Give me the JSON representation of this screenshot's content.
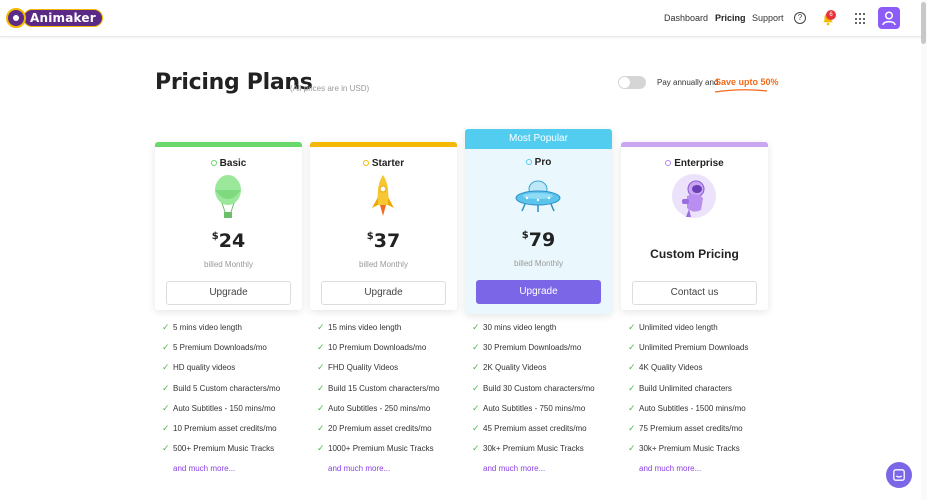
{
  "header": {
    "brand": "Animaker",
    "nav": {
      "dashboard": "Dashboard",
      "pricing": "Pricing",
      "support": "Support"
    },
    "help_glyph": "?",
    "notification_count": "6",
    "icons": [
      "help-icon",
      "bell-icon",
      "apps-grid-icon",
      "avatar-icon"
    ]
  },
  "page": {
    "title": "Pricing Plans",
    "subtitle": "(All prices are in USD)",
    "billing_toggle_label": "Pay annually and",
    "save_label": "Save upto 50%"
  },
  "plans": [
    {
      "name": "Basic",
      "accent": "#6bd86b",
      "currency": "$",
      "price": "24",
      "billed": "billed Monthly",
      "cta": "Upgrade",
      "features": [
        "5 mins video length",
        "5 Premium Downloads/mo",
        "HD quality videos",
        "Build 5 Custom characters/mo",
        "Auto Subtitles - 150 mins/mo",
        "10 Premium asset credits/mo",
        "500+ Premium Music Tracks"
      ],
      "more": "and much more..."
    },
    {
      "name": "Starter",
      "accent": "#f5b800",
      "currency": "$",
      "price": "37",
      "billed": "billed Monthly",
      "cta": "Upgrade",
      "features": [
        "15 mins video length",
        "10 Premium Downloads/mo",
        "FHD Quality Videos",
        "Build 15 Custom characters/mo",
        "Auto Subtitles - 250 mins/mo",
        "20 Premium asset credits/mo",
        "1000+ Premium Music Tracks"
      ],
      "more": "and much more..."
    },
    {
      "name": "Pro",
      "accent": "#52cdf0",
      "badge": "Most Popular",
      "currency": "$",
      "price": "79",
      "billed": "billed Monthly",
      "cta": "Upgrade",
      "features": [
        "30 mins video length",
        "30 Premium Downloads/mo",
        "2K Quality Videos",
        "Build 30 Custom characters/mo",
        "Auto Subtitles - 750 mins/mo",
        "45 Premium asset credits/mo",
        "30k+ Premium Music Tracks"
      ],
      "more": "and much more..."
    },
    {
      "name": "Enterprise",
      "accent": "#c9a6f0",
      "custom_price": "Custom Pricing",
      "cta": "Contact us",
      "features": [
        "Unlimited video length",
        "Unlimited Premium Downloads",
        "4K Quality Videos",
        "Build Unlimited characters",
        "Auto Subtitles - 1500 mins/mo",
        "75 Premium asset credits/mo",
        "30k+ Premium Music Tracks"
      ],
      "more": "and much more..."
    }
  ],
  "colors": {
    "brand_purple": "#5b2a86",
    "primary_button": "#7b66e8",
    "link_purple": "#8a3ee8",
    "save_orange": "#f26b1d",
    "check_green": "#4cbb4c"
  }
}
